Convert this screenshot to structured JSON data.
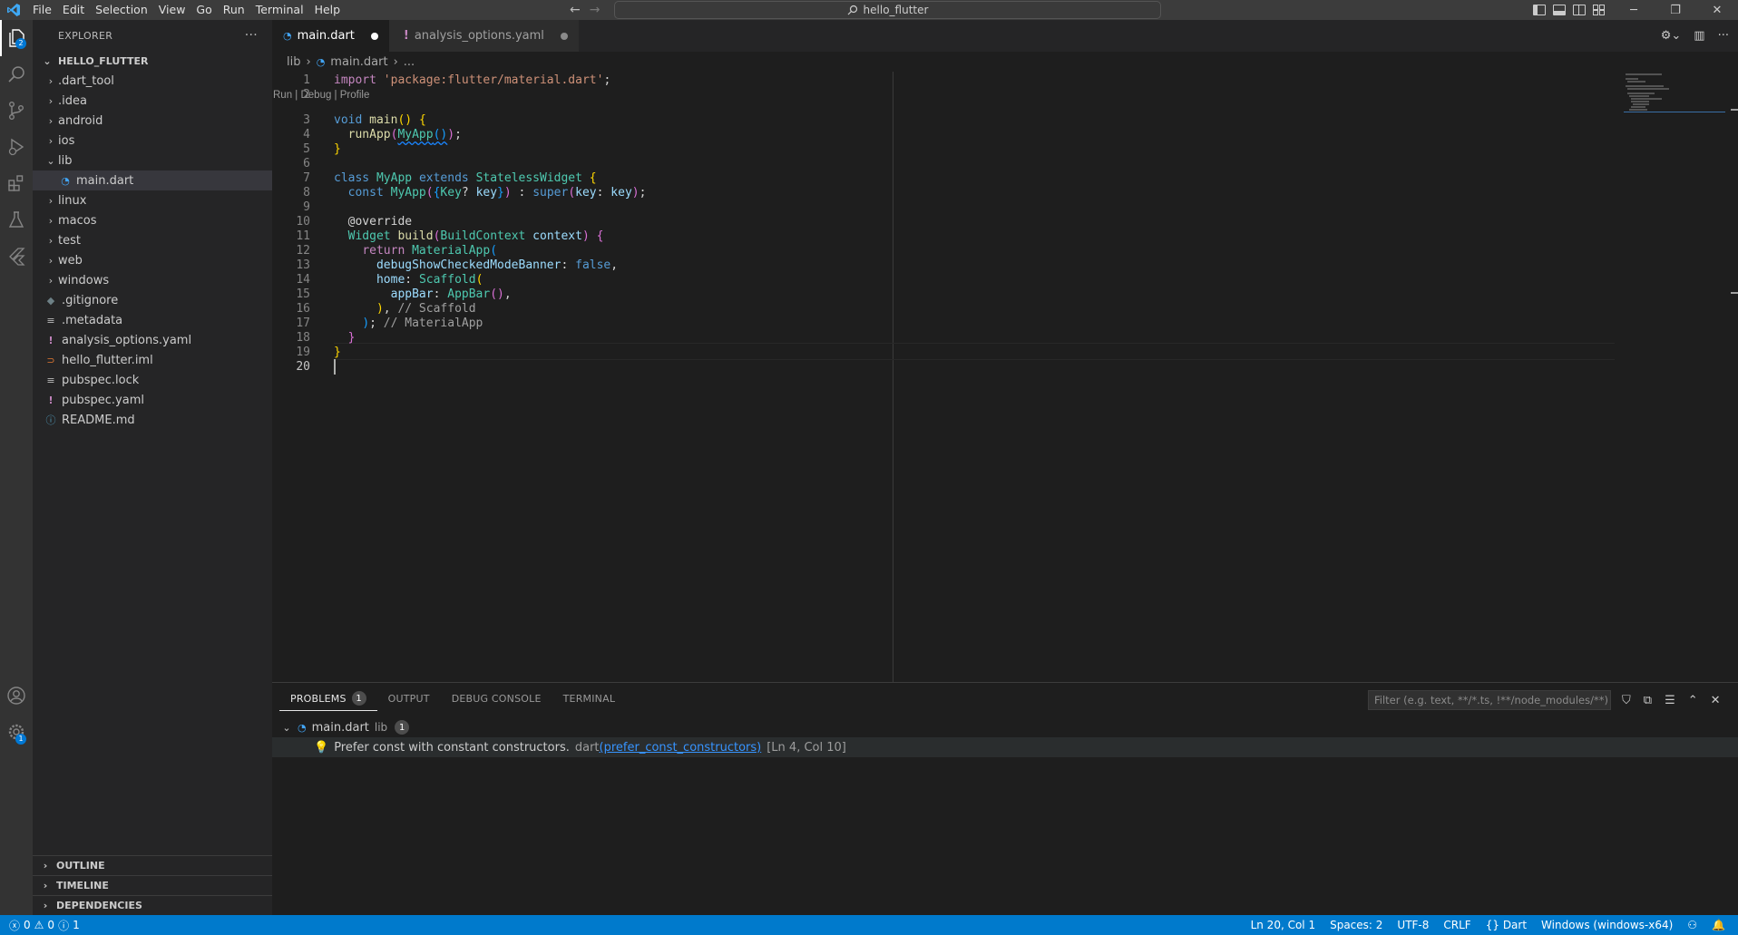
{
  "colors": {
    "accent": "#007acc",
    "titlebar": "#3c3c3c",
    "sidebar": "#252526",
    "editor": "#1e1e1e",
    "activitybar": "#333333"
  },
  "menu": [
    "File",
    "Edit",
    "Selection",
    "View",
    "Go",
    "Run",
    "Terminal",
    "Help"
  ],
  "command_center": {
    "text": "hello_flutter",
    "icon": "search-icon"
  },
  "activity": {
    "explorer_badge": "2",
    "settings_badge": "1"
  },
  "explorer": {
    "title": "EXPLORER",
    "more": "···",
    "folder": "HELLO_FLUTTER",
    "items": [
      ".dart_tool",
      ".idea",
      "android",
      "ios",
      "lib",
      "main.dart",
      "linux",
      "macos",
      "test",
      "web",
      "windows",
      ".gitignore",
      ".metadata",
      "analysis_options.yaml",
      "hello_flutter.iml",
      "pubspec.lock",
      "pubspec.yaml",
      "README.md"
    ]
  },
  "sections": [
    "OUTLINE",
    "TIMELINE",
    "DEPENDENCIES"
  ],
  "tabs": [
    {
      "label": "main.dart",
      "icon": "dart-icon"
    },
    {
      "label": "analysis_options.yaml",
      "icon": "yaml-icon"
    }
  ],
  "breadcrumb": {
    "folder": "lib",
    "file": "main.dart",
    "tail": "..."
  },
  "codelens": "Run | Debug | Profile",
  "line_numbers": [
    "1",
    "2",
    "3",
    "4",
    "5",
    "6",
    "7",
    "8",
    "9",
    "10",
    "11",
    "12",
    "13",
    "14",
    "15",
    "16",
    "17",
    "18",
    "19",
    "20"
  ],
  "code": {
    "l1_kw": "import",
    "l1_str": "'package:flutter/material.dart'",
    "l1_end": ";",
    "l3_kw": "void",
    "l3_fn": "main",
    "l3_p": "()",
    "l3_b": "{",
    "l4_fn": "runApp",
    "l4_p1": "(",
    "l4_cls": "MyApp",
    "l4_p2": "()",
    "l4_p3": ")",
    "l4_end": ";",
    "l5_b": "}",
    "l7_kw": "class",
    "l7_cls": "MyApp",
    "l7_kw2": "extends",
    "l7_cls2": "StatelessWidget",
    "l7_b": "{",
    "l8_kw": "const",
    "l8_cls": "MyApp",
    "l8_p1": "(",
    "l8_b1": "{",
    "l8_cls2": "Key",
    "l8_q": "?",
    "l8_var": "key",
    "l8_b2": "}",
    "l8_p2": ")",
    "l8_colon": ":",
    "l8_kw2": "super",
    "l8_p3": "(",
    "l8_var2": "key",
    "l8_colon2": ":",
    "l8_var3": "key",
    "l8_p4": ")",
    "l8_end": ";",
    "l10_ann": "@override",
    "l11_cls": "Widget",
    "l11_fn": "build",
    "l11_p1": "(",
    "l11_cls2": "BuildContext",
    "l11_var": "context",
    "l11_p2": ")",
    "l11_b": "{",
    "l12_kw": "return",
    "l12_cls": "MaterialApp",
    "l12_p": "(",
    "l13_var": "debugShowCheckedModeBanner",
    "l13_colon": ":",
    "l13_kw": "false",
    "l13_comma": ",",
    "l14_var": "home",
    "l14_colon": ":",
    "l14_cls": "Scaffold",
    "l14_p": "(",
    "l15_var": "appBar",
    "l15_colon": ":",
    "l15_cls": "AppBar",
    "l15_p": "()",
    "l15_comma": ",",
    "l16_p": ")",
    "l16_comma": ",",
    "l16_cmt": "// Scaffold",
    "l17_p": ")",
    "l17_end": ";",
    "l17_cmt": "// MaterialApp",
    "l18_b": "}",
    "l19_b": "}"
  },
  "panel": {
    "tabs": [
      "PROBLEMS",
      "OUTPUT",
      "DEBUG CONSOLE",
      "TERMINAL"
    ],
    "problems_count": "1",
    "filter_placeholder": "Filter (e.g. text, **/*.ts, !**/node_modules/**)",
    "file": {
      "name": "main.dart",
      "folder": "lib",
      "count": "1"
    },
    "problem": {
      "message": "Prefer const with constant constructors.",
      "source": "dart",
      "code": "(prefer_const_constructors)",
      "location": "[Ln 4, Col 10]"
    }
  },
  "status": {
    "errors": "0",
    "warnings": "0",
    "info": "1",
    "position": "Ln 20, Col 1",
    "spaces": "Spaces: 2",
    "encoding": "UTF-8",
    "eol": "CRLF",
    "language": "Dart",
    "device": "Windows (windows-x64)"
  }
}
